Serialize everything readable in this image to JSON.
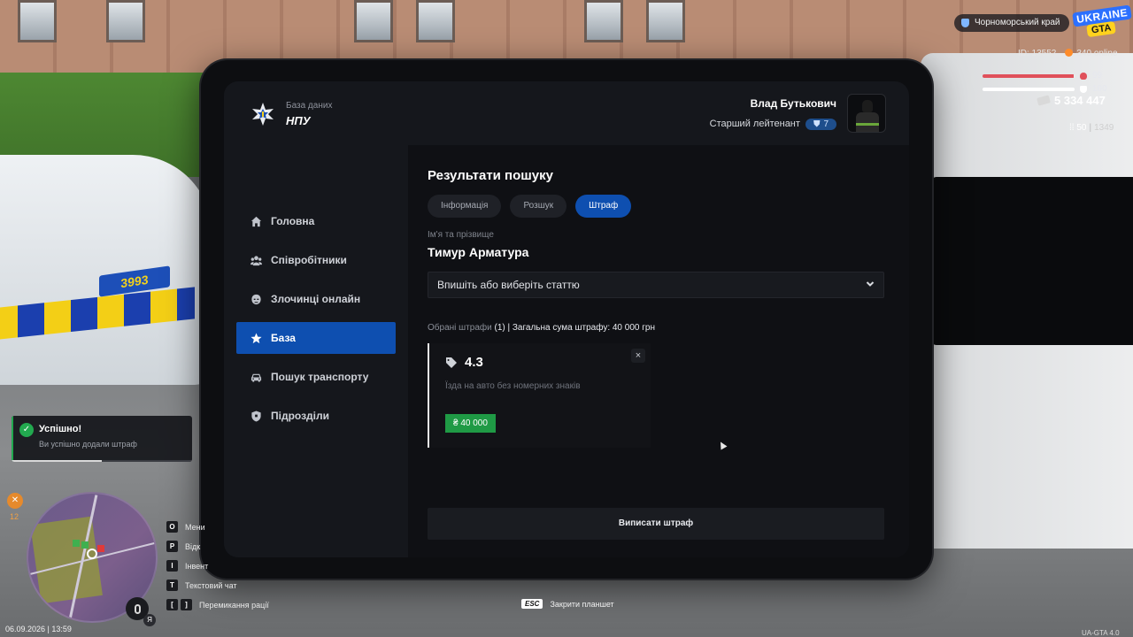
{
  "hud": {
    "region": "Чорноморський край",
    "logo_line1": "UKRAINE",
    "logo_line2": "GTA",
    "player_id": "ID: 13552",
    "online": "340 online",
    "health": 99,
    "armor": 100,
    "money": "5 334 447",
    "ammo_clip": "50",
    "ammo_total": "1349",
    "hunger": "12",
    "datetime": "06.09.2026 | 13:59",
    "version": "UA-GTA 4.0",
    "esc_key": "ESC",
    "esc_label": "Закрити планшет",
    "mic_key": "Я",
    "plate": "3993",
    "keybinds": [
      {
        "keys": [
          "O"
        ],
        "label": "Мени"
      },
      {
        "keys": [
          "P"
        ],
        "label": "Відк"
      },
      {
        "keys": [
          "I"
        ],
        "label": "Інвент"
      },
      {
        "keys": [
          "T"
        ],
        "label": "Текстовий чат"
      },
      {
        "keys": [
          "[",
          "]"
        ],
        "label": "Перемикання рації"
      }
    ],
    "colors": {
      "health": "#e0505a",
      "armor": "#ffffff",
      "online": "#ff8c2a"
    }
  },
  "toast": {
    "title": "Успішно!",
    "message": "Ви успішно додали штраф",
    "progress": 0.5
  },
  "tablet": {
    "brand_sub": "База даних",
    "brand_title": "НПУ",
    "user": {
      "name": "Влад Бутькович",
      "rank": "Старший лейтенант",
      "rank_level": "7"
    },
    "nav": [
      {
        "label": "Головна",
        "icon": "home-icon",
        "active": false
      },
      {
        "label": "Співробітники",
        "icon": "users-icon",
        "active": false
      },
      {
        "label": "Злочинці онлайн",
        "icon": "criminal-icon",
        "active": false
      },
      {
        "label": "База",
        "icon": "star-icon",
        "active": true
      },
      {
        "label": "Пошук транспорту",
        "icon": "car-icon",
        "active": false
      },
      {
        "label": "Підрозділи",
        "icon": "shield-icon",
        "active": false
      }
    ],
    "main": {
      "title": "Результати пошуку",
      "tabs": [
        {
          "label": "Інформація",
          "active": false
        },
        {
          "label": "Розшук",
          "active": false
        },
        {
          "label": "Штраф",
          "active": true
        }
      ],
      "field_label": "Ім'я та прізвище",
      "person_name": "Тимур Арматура",
      "select_placeholder": "Впишіть або виберіть статтю",
      "summary_prefix": "Обрані штрафи",
      "summary_count": "(1)",
      "summary_total": "| Загальна сума штрафу: 40 000 грн",
      "fines": [
        {
          "code": "4.3",
          "description": "Їзда на авто без номерних знаків",
          "amount": "₴ 40 000"
        }
      ],
      "close_symbol": "×",
      "submit_label": "Виписати штраф"
    },
    "accent_color": "#0e4fb0"
  }
}
